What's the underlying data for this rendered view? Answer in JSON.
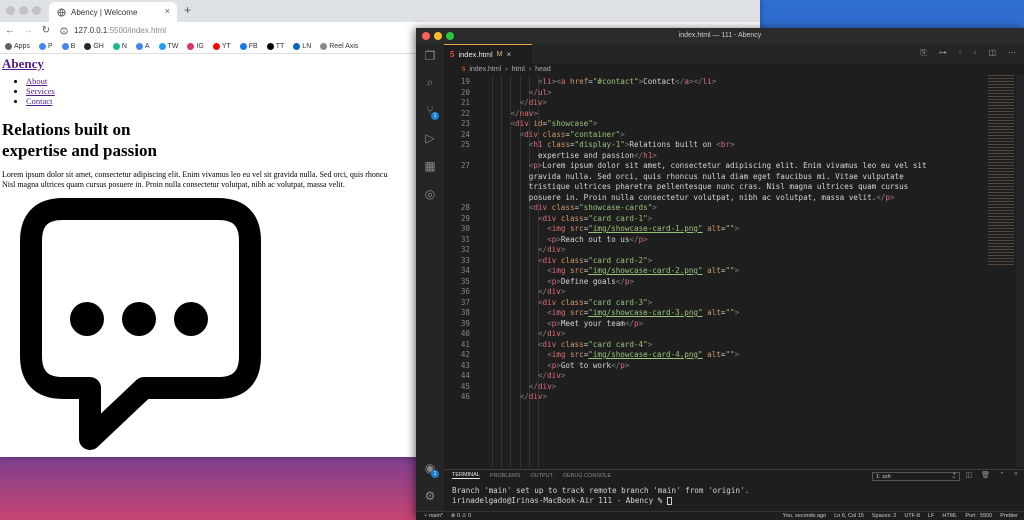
{
  "browser": {
    "tab_title": "Abency | Welcome",
    "new_tab": "+",
    "url_host": "127.0.0.1",
    "url_rest": ":5500/index.html",
    "bookmarks": [
      {
        "label": "Apps",
        "color": "#5f6368"
      },
      {
        "label": "P",
        "color": "#4285f4"
      },
      {
        "label": "B",
        "color": "#4285f4"
      },
      {
        "label": "GH",
        "color": "#24292e"
      },
      {
        "label": "N",
        "color": "#1fb58f"
      },
      {
        "label": "A",
        "color": "#4285f4"
      },
      {
        "label": "TW",
        "color": "#1da1f2"
      },
      {
        "label": "IG",
        "color": "#e1306c"
      },
      {
        "label": "YT",
        "color": "#ff0000"
      },
      {
        "label": "FB",
        "color": "#1877f2"
      },
      {
        "label": "TT",
        "color": "#000000"
      },
      {
        "label": "LN",
        "color": "#0a66c2"
      },
      {
        "label": "Reel Axis",
        "color": "#8a8a8a"
      }
    ]
  },
  "page": {
    "brand": "Abency",
    "nav": [
      "About",
      "Services",
      "Contact"
    ],
    "heading_line1": "Relations built on",
    "heading_line2": "expertise and passion",
    "lorem_line1": "Lorem ipsum dolor sit amet, consectetur adipiscing elit. Enim vivamus leo eu vel sit gravida nulla. Sed orci, quis rhoncu",
    "lorem_line2": "Nisl magna ultrices quam cursus posuere in. Proin nulla consectetur volutpat, nibh ac volutpat, massa velit."
  },
  "vscode": {
    "window_title": "index.html — 111 - Abency",
    "tab_label": "index.html",
    "tab_modified": "M",
    "breadcrumb": [
      "index.html",
      "html",
      "head"
    ],
    "panel_tabs": [
      "TERMINAL",
      "PROBLEMS",
      "OUTPUT",
      "DEBUG CONSOLE"
    ],
    "terminal_select": "1: zsh",
    "terminal_lines": [
      "Branch 'main' set up to track remote branch 'main' from 'origin'.",
      "irinadelgado@Irinas-MacBook-Air 111 - Abency % "
    ],
    "status_left": [
      "main*",
      "⊗ 0 ⚠ 0"
    ],
    "status_right": [
      "You, seconds ago",
      "Ln 6, Col 15",
      "Spaces: 2",
      "UTF-8",
      "LF",
      "HTML",
      "Port : 5500",
      "Prettier"
    ],
    "badges": {
      "scm": "1",
      "accounts": "1"
    }
  },
  "code_lines": [
    {
      "n": "19",
      "indent": 6,
      "tokens": [
        [
          "tg",
          "<"
        ],
        [
          "tn",
          "li"
        ],
        [
          "tg",
          ">"
        ],
        [
          "tg",
          "<"
        ],
        [
          "tn",
          "a"
        ],
        [
          "at",
          " href"
        ],
        [
          "tx",
          "="
        ],
        [
          "st",
          "\"#contact\""
        ],
        [
          "tg",
          ">"
        ],
        [
          "tx",
          "Contact"
        ],
        [
          "tg",
          "</"
        ],
        [
          "tn",
          "a"
        ],
        [
          "tg",
          "></"
        ],
        [
          "tn",
          "li"
        ],
        [
          "tg",
          ">"
        ]
      ]
    },
    {
      "n": "20",
      "indent": 5,
      "tokens": [
        [
          "tg",
          "</"
        ],
        [
          "tn",
          "ul"
        ],
        [
          "tg",
          ">"
        ]
      ]
    },
    {
      "n": "21",
      "indent": 4,
      "tokens": [
        [
          "tg",
          "</"
        ],
        [
          "tn",
          "div"
        ],
        [
          "tg",
          ">"
        ]
      ]
    },
    {
      "n": "22",
      "indent": 3,
      "tokens": [
        [
          "tg",
          "</"
        ],
        [
          "tn",
          "nav"
        ],
        [
          "tg",
          ">"
        ]
      ]
    },
    {
      "n": "23",
      "indent": 3,
      "tokens": [
        [
          "tg",
          "<"
        ],
        [
          "tn",
          "div"
        ],
        [
          "at",
          " id"
        ],
        [
          "tx",
          "="
        ],
        [
          "st",
          "\"showcase\""
        ],
        [
          "tg",
          ">"
        ]
      ]
    },
    {
      "n": "24",
      "indent": 4,
      "tokens": [
        [
          "tg",
          "<"
        ],
        [
          "tn",
          "div"
        ],
        [
          "at",
          " class"
        ],
        [
          "tx",
          "="
        ],
        [
          "st",
          "\"container\""
        ],
        [
          "tg",
          ">"
        ]
      ]
    },
    {
      "n": "25",
      "indent": 5,
      "tokens": [
        [
          "tg",
          "<"
        ],
        [
          "tn",
          "h1"
        ],
        [
          "at",
          " class"
        ],
        [
          "tx",
          "="
        ],
        [
          "st",
          "\"display-1\""
        ],
        [
          "tg",
          ">"
        ],
        [
          "tx",
          "Relations built on "
        ],
        [
          "tg",
          "<"
        ],
        [
          "tn",
          "br"
        ],
        [
          "tg",
          ">"
        ]
      ]
    },
    {
      "n": "",
      "indent": 6,
      "tokens": [
        [
          "tx",
          "expertise and passion"
        ],
        [
          "tg",
          "</"
        ],
        [
          "tn",
          "h1"
        ],
        [
          "tg",
          ">"
        ]
      ]
    },
    {
      "n": "27",
      "indent": 5,
      "tokens": [
        [
          "tg",
          "<"
        ],
        [
          "tn",
          "p"
        ],
        [
          "tg",
          ">"
        ],
        [
          "tx",
          "Lorem ipsum dolor sit amet, consectetur adipiscing elit. Enim vivamus leo eu vel sit"
        ]
      ]
    },
    {
      "n": "",
      "indent": 5,
      "tokens": [
        [
          "tx",
          "gravida nulla. Sed orci, quis rhoncus nulla diam eget faucibus mi. Vitae vulputate"
        ]
      ]
    },
    {
      "n": "",
      "indent": 5,
      "tokens": [
        [
          "tx",
          "tristique ultrices pharetra pellentesque nunc cras. Nisl magna ultrices quam cursus"
        ]
      ]
    },
    {
      "n": "",
      "indent": 5,
      "tokens": [
        [
          "tx",
          "posuere in. Proin nulla consectetur volutpat, nibh ac volutpat, massa velit."
        ],
        [
          "tg",
          "</"
        ],
        [
          "tn",
          "p"
        ],
        [
          "tg",
          ">"
        ]
      ]
    },
    {
      "n": "28",
      "indent": 5,
      "tokens": [
        [
          "tg",
          "<"
        ],
        [
          "tn",
          "div"
        ],
        [
          "at",
          " class"
        ],
        [
          "tx",
          "="
        ],
        [
          "st",
          "\"showcase-cards\""
        ],
        [
          "tg",
          ">"
        ]
      ]
    },
    {
      "n": "29",
      "indent": 6,
      "tokens": [
        [
          "tg",
          "<"
        ],
        [
          "tn",
          "div"
        ],
        [
          "at",
          " class"
        ],
        [
          "tx",
          "="
        ],
        [
          "st",
          "\"card card-1\""
        ],
        [
          "tg",
          ">"
        ]
      ]
    },
    {
      "n": "30",
      "indent": 7,
      "tokens": [
        [
          "tg",
          "<"
        ],
        [
          "tn",
          "img"
        ],
        [
          "at",
          " src"
        ],
        [
          "tx",
          "="
        ],
        [
          "stu",
          "\"img/showcase-card-1.png\""
        ],
        [
          "at",
          " alt"
        ],
        [
          "tx",
          "="
        ],
        [
          "st",
          "\"\""
        ],
        [
          "tg",
          ">"
        ]
      ]
    },
    {
      "n": "31",
      "indent": 7,
      "tokens": [
        [
          "tg",
          "<"
        ],
        [
          "tn",
          "p"
        ],
        [
          "tg",
          ">"
        ],
        [
          "tx",
          "Reach out to us"
        ],
        [
          "tg",
          "</"
        ],
        [
          "tn",
          "p"
        ],
        [
          "tg",
          ">"
        ]
      ]
    },
    {
      "n": "32",
      "indent": 6,
      "tokens": [
        [
          "tg",
          "</"
        ],
        [
          "tn",
          "div"
        ],
        [
          "tg",
          ">"
        ]
      ]
    },
    {
      "n": "33",
      "indent": 6,
      "tokens": [
        [
          "tg",
          "<"
        ],
        [
          "tn",
          "div"
        ],
        [
          "at",
          " class"
        ],
        [
          "tx",
          "="
        ],
        [
          "st",
          "\"card card-2\""
        ],
        [
          "tg",
          ">"
        ]
      ]
    },
    {
      "n": "34",
      "indent": 7,
      "tokens": [
        [
          "tg",
          "<"
        ],
        [
          "tn",
          "img"
        ],
        [
          "at",
          " src"
        ],
        [
          "tx",
          "="
        ],
        [
          "stu",
          "\"img/showcase-card-2.png\""
        ],
        [
          "at",
          " alt"
        ],
        [
          "tx",
          "="
        ],
        [
          "st",
          "\"\""
        ],
        [
          "tg",
          ">"
        ]
      ]
    },
    {
      "n": "35",
      "indent": 7,
      "tokens": [
        [
          "tg",
          "<"
        ],
        [
          "tn",
          "p"
        ],
        [
          "tg",
          ">"
        ],
        [
          "tx",
          "Define goals"
        ],
        [
          "tg",
          "</"
        ],
        [
          "tn",
          "p"
        ],
        [
          "tg",
          ">"
        ]
      ]
    },
    {
      "n": "36",
      "indent": 6,
      "tokens": [
        [
          "tg",
          "</"
        ],
        [
          "tn",
          "div"
        ],
        [
          "tg",
          ">"
        ]
      ]
    },
    {
      "n": "37",
      "indent": 6,
      "tokens": [
        [
          "tg",
          "<"
        ],
        [
          "tn",
          "div"
        ],
        [
          "at",
          " class"
        ],
        [
          "tx",
          "="
        ],
        [
          "st",
          "\"card card-3\""
        ],
        [
          "tg",
          ">"
        ]
      ]
    },
    {
      "n": "38",
      "indent": 7,
      "tokens": [
        [
          "tg",
          "<"
        ],
        [
          "tn",
          "img"
        ],
        [
          "at",
          " src"
        ],
        [
          "tx",
          "="
        ],
        [
          "stu",
          "\"img/showcase-card-3.png\""
        ],
        [
          "at",
          " alt"
        ],
        [
          "tx",
          "="
        ],
        [
          "st",
          "\"\""
        ],
        [
          "tg",
          ">"
        ]
      ]
    },
    {
      "n": "39",
      "indent": 7,
      "tokens": [
        [
          "tg",
          "<"
        ],
        [
          "tn",
          "p"
        ],
        [
          "tg",
          ">"
        ],
        [
          "tx",
          "Meet your team"
        ],
        [
          "tg",
          "</"
        ],
        [
          "tn",
          "p"
        ],
        [
          "tg",
          ">"
        ]
      ]
    },
    {
      "n": "40",
      "indent": 6,
      "tokens": [
        [
          "tg",
          "</"
        ],
        [
          "tn",
          "div"
        ],
        [
          "tg",
          ">"
        ]
      ]
    },
    {
      "n": "41",
      "indent": 6,
      "tokens": [
        [
          "tg",
          "<"
        ],
        [
          "tn",
          "div"
        ],
        [
          "at",
          " class"
        ],
        [
          "tx",
          "="
        ],
        [
          "st",
          "\"card card-4\""
        ],
        [
          "tg",
          ">"
        ]
      ]
    },
    {
      "n": "42",
      "indent": 7,
      "tokens": [
        [
          "tg",
          "<"
        ],
        [
          "tn",
          "img"
        ],
        [
          "at",
          " src"
        ],
        [
          "tx",
          "="
        ],
        [
          "stu",
          "\"img/showcase-card-4.png\""
        ],
        [
          "at",
          " alt"
        ],
        [
          "tx",
          "="
        ],
        [
          "st",
          "\"\""
        ],
        [
          "tg",
          ">"
        ]
      ]
    },
    {
      "n": "43",
      "indent": 7,
      "tokens": [
        [
          "tg",
          "<"
        ],
        [
          "tn",
          "p"
        ],
        [
          "tg",
          ">"
        ],
        [
          "tx",
          "Got to work"
        ],
        [
          "tg",
          "</"
        ],
        [
          "tn",
          "p"
        ],
        [
          "tg",
          ">"
        ]
      ]
    },
    {
      "n": "44",
      "indent": 6,
      "tokens": [
        [
          "tg",
          "</"
        ],
        [
          "tn",
          "div"
        ],
        [
          "tg",
          ">"
        ]
      ]
    },
    {
      "n": "45",
      "indent": 5,
      "tokens": [
        [
          "tg",
          "</"
        ],
        [
          "tn",
          "div"
        ],
        [
          "tg",
          ">"
        ]
      ]
    },
    {
      "n": "46",
      "indent": 4,
      "tokens": [
        [
          "tg",
          "</"
        ],
        [
          "tn",
          "div"
        ],
        [
          "tg",
          ">"
        ]
      ]
    }
  ]
}
